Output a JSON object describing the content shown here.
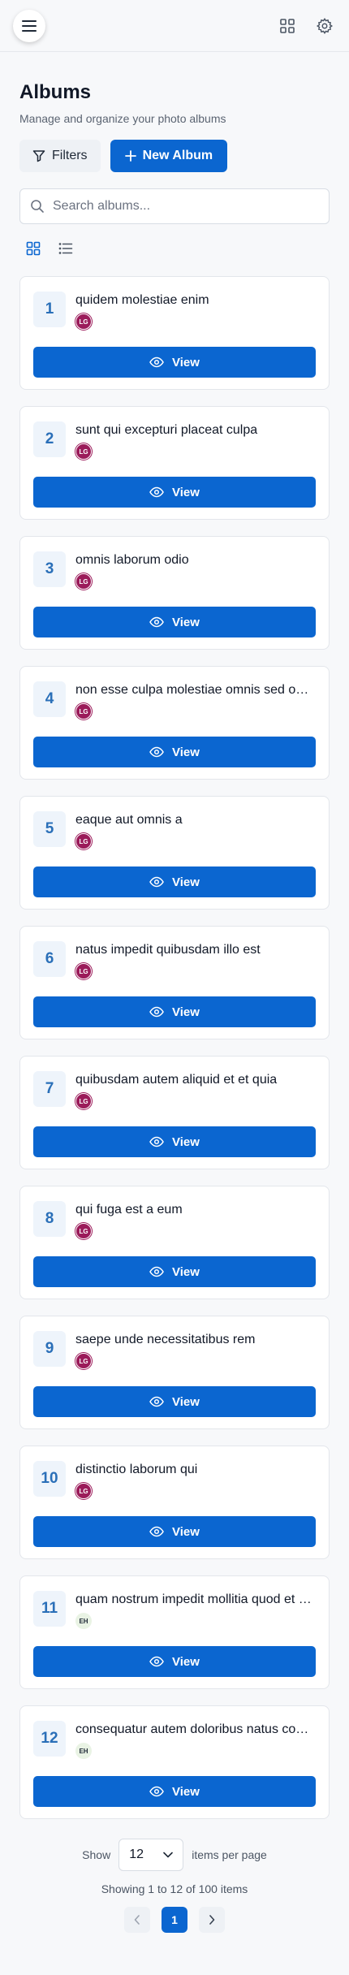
{
  "header": {
    "menu_icon": "hamburger-menu-icon",
    "grid_icon": "grid-icon",
    "settings_icon": "gear-icon"
  },
  "page": {
    "title": "Albums",
    "subtitle": "Manage and organize your photo albums"
  },
  "actions": {
    "filters_label": "Filters",
    "new_album_label": "New Album"
  },
  "search": {
    "placeholder": "Search albums...",
    "value": ""
  },
  "view_toggle": {
    "active": "grid"
  },
  "colors": {
    "primary": "#0b66d0",
    "avatar_lg": "#9b1b5a",
    "avatar_eh": "#e9f3e4"
  },
  "albums": [
    {
      "number": "1",
      "title": "quidem molestiae enim",
      "owner": "LG"
    },
    {
      "number": "2",
      "title": "sunt qui excepturi placeat culpa",
      "owner": "LG"
    },
    {
      "number": "3",
      "title": "omnis laborum odio",
      "owner": "LG"
    },
    {
      "number": "4",
      "title": "non esse culpa molestiae omnis sed optio",
      "owner": "LG"
    },
    {
      "number": "5",
      "title": "eaque aut omnis a",
      "owner": "LG"
    },
    {
      "number": "6",
      "title": "natus impedit quibusdam illo est",
      "owner": "LG"
    },
    {
      "number": "7",
      "title": "quibusdam autem aliquid et et quia",
      "owner": "LG"
    },
    {
      "number": "8",
      "title": "qui fuga est a eum",
      "owner": "LG"
    },
    {
      "number": "9",
      "title": "saepe unde necessitatibus rem",
      "owner": "LG"
    },
    {
      "number": "10",
      "title": "distinctio laborum qui",
      "owner": "LG"
    },
    {
      "number": "11",
      "title": "quam nostrum impedit mollitia quod et dolor",
      "owner": "EH"
    },
    {
      "number": "12",
      "title": "consequatur autem doloribus natus consectetur",
      "owner": "EH"
    }
  ],
  "view_label": "View",
  "pagination": {
    "show_label": "Show",
    "per_page_value": "12",
    "per_page_suffix": "items per page",
    "showing_text": "Showing 1 to 12 of 100 items",
    "current_page": "1"
  }
}
